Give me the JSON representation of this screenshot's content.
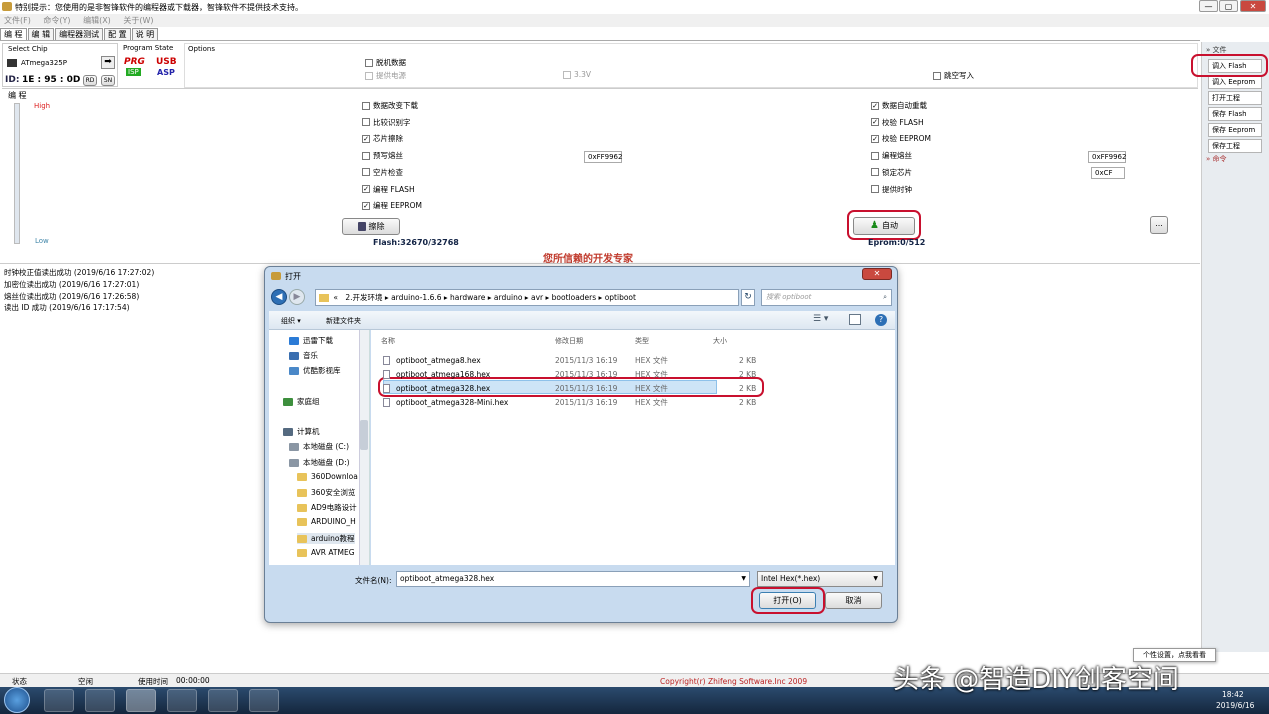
{
  "window": {
    "title": "特别提示：您使用的是非智锋软件的编程器或下载器，智锋软件不提供技术支持。",
    "controls": [
      "—",
      "▢",
      "✕"
    ]
  },
  "menu": [
    "文件(F)",
    "命令(Y)",
    "编辑(X)",
    "关于(W)"
  ],
  "tabs": [
    "编 程",
    "编 辑",
    "编程器测试",
    "配 置",
    "说 明"
  ],
  "chip": {
    "section_label": "Select Chip",
    "name": "ATmega325P",
    "id_label": "ID:",
    "id_value": "1E : 95 : 0D",
    "rd": "RD",
    "sn": "SN"
  },
  "program_state": {
    "label": "Program State",
    "prg": "PRG",
    "isp": "ISP",
    "usb": "USB",
    "asp": "ASP"
  },
  "options": {
    "label": "Options",
    "offline": "脱机数据",
    "power": "提供电源",
    "voltage": "3.3V",
    "skip_empty": "跳空写入"
  },
  "program_section": {
    "label": "编 程",
    "high": "High",
    "low": "Low",
    "left_checks": [
      {
        "label": "数据改变下载",
        "checked": false
      },
      {
        "label": "比较识别字",
        "checked": false
      },
      {
        "label": "芯片擦除",
        "checked": true
      },
      {
        "label": "预写熔丝",
        "checked": false
      },
      {
        "label": "空片检查",
        "checked": false
      },
      {
        "label": "编程 FLASH",
        "checked": true
      },
      {
        "label": "编程 EEPROM",
        "checked": true
      }
    ],
    "right_checks": [
      {
        "label": "数据自动重载",
        "checked": true
      },
      {
        "label": "校验 FLASH",
        "checked": true
      },
      {
        "label": "校验 EEPROM",
        "checked": true
      },
      {
        "label": "编程熔丝",
        "checked": false
      },
      {
        "label": "锁定芯片",
        "checked": false
      },
      {
        "label": "提供时钟",
        "checked": false
      }
    ],
    "fuse_left": "0xFF9962",
    "fuse_right": "0xFF9962",
    "lock_value": "0xCF",
    "erase_button": "擦除",
    "auto_button": "自动",
    "more_button": "...",
    "flash_info": "Flash:32670/32768",
    "eprom_info": "Eprom:0/512"
  },
  "slogan": "您所信赖的开发专家",
  "sidebar": {
    "file_header": "文件",
    "items": [
      "调入 Flash",
      "调入 Eeprom",
      "打开工程",
      "保存 Flash",
      "保存 Eeprom",
      "保存工程"
    ],
    "cmd_header": "命令"
  },
  "log": [
    "时钟校正值读出成功 (2019/6/16 17:27:02)",
    "加密位读出成功 (2019/6/16 17:27:01)",
    "熔丝位读出成功 (2019/6/16 17:26:58)",
    "读出 ID 成功 (2019/6/16 17:17:54)"
  ],
  "dialog": {
    "title": "打开",
    "breadcrumb": [
      "«",
      "2.开发环境",
      "arduino-1.6.6",
      "hardware",
      "arduino",
      "avr",
      "bootloaders",
      "optiboot"
    ],
    "search_placeholder": "搜索 optiboot",
    "organize": "组织 ▾",
    "new_folder": "新建文件夹",
    "nav": [
      {
        "label": "迅雷下载",
        "icon": "download"
      },
      {
        "label": "音乐",
        "icon": "music"
      },
      {
        "label": "优酷影视库",
        "icon": "video"
      },
      {
        "label": "家庭组",
        "icon": "homegroup"
      },
      {
        "label": "计算机",
        "icon": "computer"
      },
      {
        "label": "本地磁盘 (C:)",
        "icon": "disk"
      },
      {
        "label": "本地磁盘 (D:)",
        "icon": "disk"
      },
      {
        "label": "360Downloa",
        "icon": "folder"
      },
      {
        "label": "360安全浏览",
        "icon": "folder"
      },
      {
        "label": "AD9电路设计",
        "icon": "folder"
      },
      {
        "label": "ARDUINO_H",
        "icon": "folder"
      },
      {
        "label": "arduino教程",
        "icon": "folder"
      },
      {
        "label": "AVR ATMEG",
        "icon": "folder"
      }
    ],
    "columns": [
      "名称",
      "修改日期",
      "类型",
      "大小"
    ],
    "files": [
      {
        "name": "optiboot_atmega8.hex",
        "date": "2015/11/3 16:19",
        "type": "HEX 文件",
        "size": "2 KB"
      },
      {
        "name": "optiboot_atmega168.hex",
        "date": "2015/11/3 16:19",
        "type": "HEX 文件",
        "size": "2 KB"
      },
      {
        "name": "optiboot_atmega328.hex",
        "date": "2015/11/3 16:19",
        "type": "HEX 文件",
        "size": "2 KB"
      },
      {
        "name": "optiboot_atmega328-Mini.hex",
        "date": "2015/11/3 16:19",
        "type": "HEX 文件",
        "size": "2 KB"
      }
    ],
    "filename_label": "文件名(N):",
    "filename_value": "optiboot_atmega328.hex",
    "filter": "Intel Hex(*.hex)",
    "open_button": "打开(O)",
    "cancel_button": "取消"
  },
  "status": {
    "state_label": "状态",
    "state_value": "空闲",
    "time_label": "使用时间",
    "time_value": "00:00:00",
    "copyright": "Copyright(r) Zhifeng Software.Inc 2009"
  },
  "tooltip": "个性设置，点我看看",
  "watermark": "头条 @智造DIY创客空间",
  "clock": {
    "time": "18:42",
    "date": "2019/6/16"
  },
  "colors": {
    "accent_red": "#c8102e",
    "slogan": "#c0392b",
    "high": "#d22",
    "copyright": "#b22"
  }
}
